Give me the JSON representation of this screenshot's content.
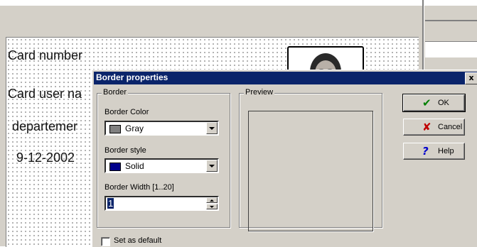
{
  "canvas": {
    "card_number": "Card number",
    "card_user_name": "Card user na",
    "department": "departemer",
    "date": "9-12-2002"
  },
  "dialog": {
    "title": "Border properties",
    "close_label": "x",
    "border_group": {
      "legend": "Border",
      "color_label": "Border Color",
      "color_value": "Gray",
      "color_swatch": "#808080",
      "style_label": "Border style",
      "style_value": "Solid",
      "style_swatch": "#00008b",
      "width_label": "Border Width [1..20]",
      "width_value": "1"
    },
    "preview_group": {
      "legend": "Preview"
    },
    "buttons": {
      "ok": "OK",
      "cancel": "Cancel",
      "help": "Help"
    },
    "set_default_label": "Set as default"
  },
  "colors": {
    "titlebar": "#0a246a",
    "ok_icon": "#008000",
    "cancel_icon": "#c00000",
    "help_icon": "#0000cc"
  }
}
